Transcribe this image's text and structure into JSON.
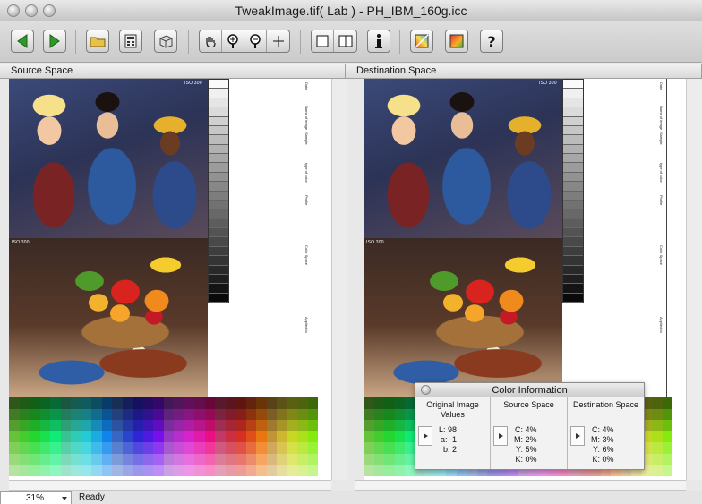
{
  "window": {
    "title": "TweakImage.tif( Lab ) - PH_IBM_160g.icc"
  },
  "toolbar": {
    "buttons": [
      {
        "name": "back-icon",
        "color": "#2f9a2a"
      },
      {
        "name": "forward-icon",
        "color": "#2f9a2a"
      },
      {
        "name": "open-folder-icon"
      },
      {
        "name": "calculator-icon"
      },
      {
        "name": "box-icon"
      },
      {
        "name": "hand-icon"
      },
      {
        "name": "zoom-in-icon"
      },
      {
        "name": "zoom-out-icon"
      },
      {
        "name": "crosshair-icon"
      },
      {
        "name": "single-view-icon"
      },
      {
        "name": "split-view-icon"
      },
      {
        "name": "info-icon"
      },
      {
        "name": "gamut-icon"
      },
      {
        "name": "gradient-icon"
      },
      {
        "name": "help-icon"
      }
    ]
  },
  "panes": {
    "source_label": "Source Space",
    "destination_label": "Destination Space"
  },
  "image": {
    "iso_top": "ISO 300",
    "iso_mid": "ISO 300",
    "side_labels": [
      "Date",
      "Name of image",
      "Sample",
      "type of color",
      "Profile",
      "Color Space",
      "Applied to"
    ]
  },
  "color_info": {
    "title": "Color Information",
    "original": {
      "header": "Original Image Values",
      "lines": [
        "L: 98",
        "a: -1",
        "b: 2"
      ]
    },
    "source": {
      "header": "Source Space",
      "lines": [
        "C: 4%",
        "M: 2%",
        "Y: 5%",
        "K: 0%"
      ]
    },
    "destination": {
      "header": "Destination Space",
      "lines": [
        "C: 4%",
        "M: 3%",
        "Y: 6%",
        "K: 0%"
      ]
    }
  },
  "status": {
    "zoom": "31%",
    "text": "Ready"
  }
}
